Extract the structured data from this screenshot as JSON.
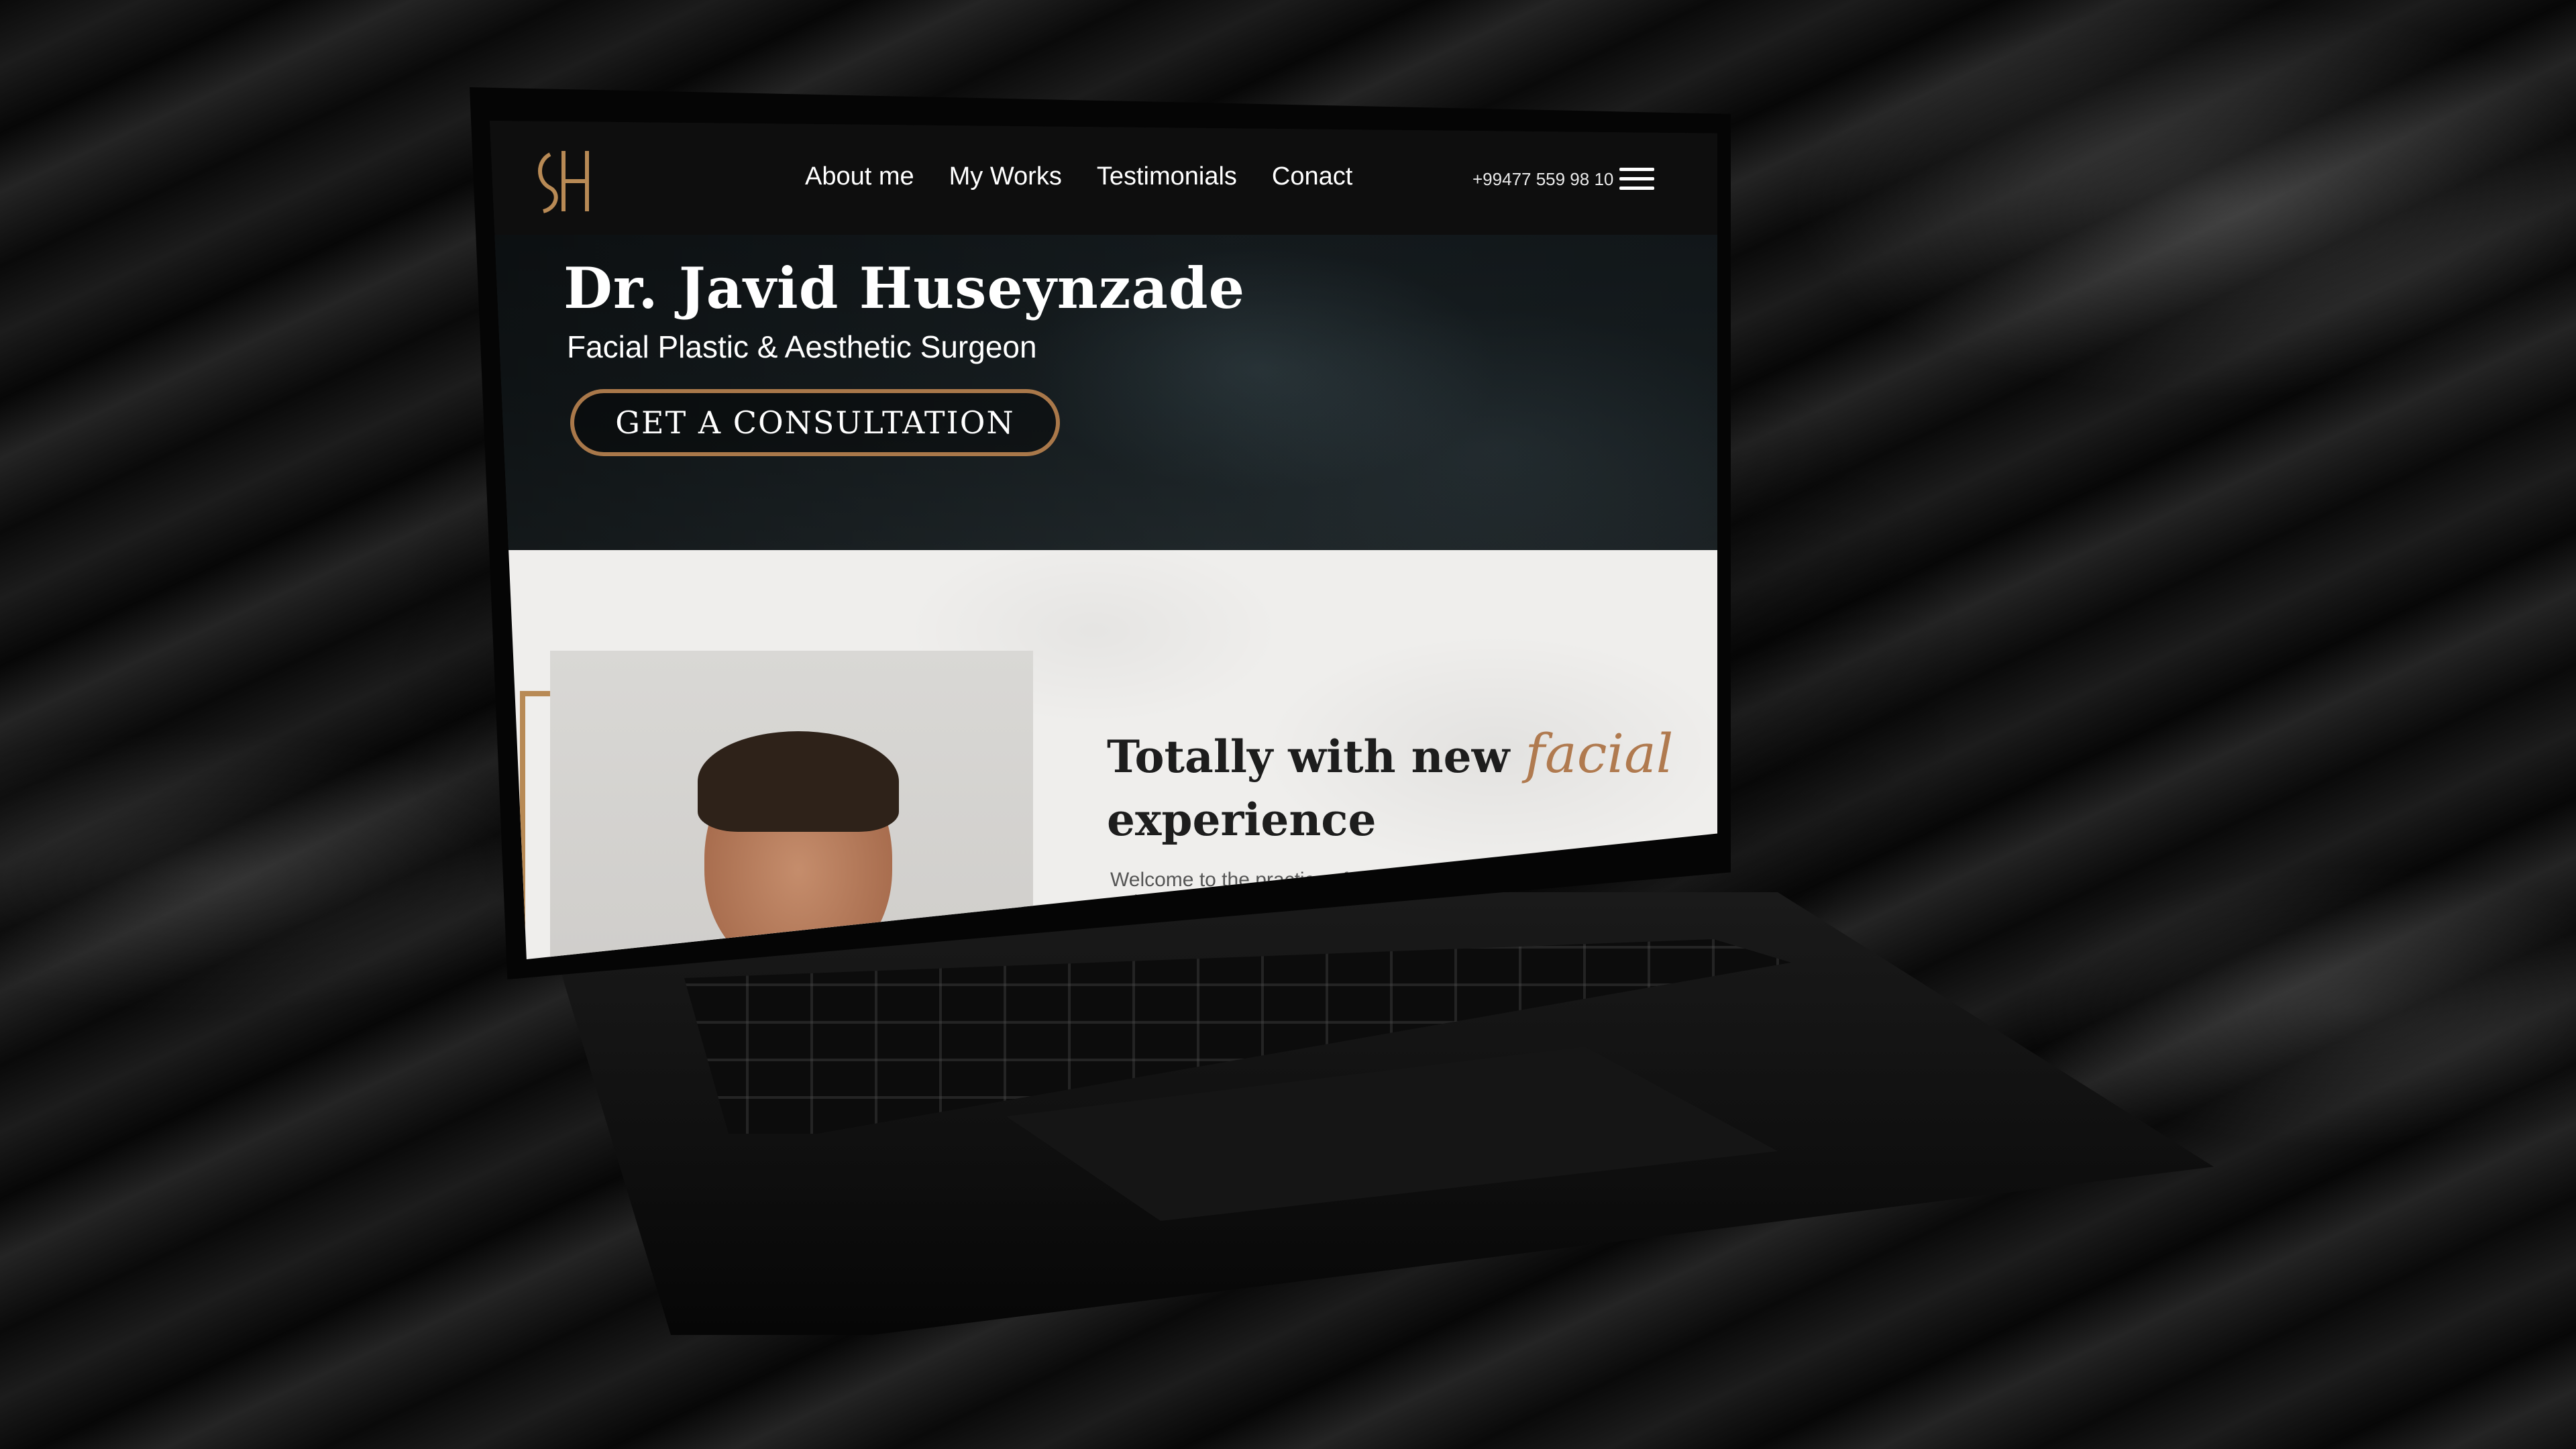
{
  "site": {
    "logo_text": "JH",
    "nav": [
      {
        "label": "About me"
      },
      {
        "label": "My Works"
      },
      {
        "label": "Testimonials"
      },
      {
        "label": "Conact"
      }
    ],
    "phone": "+99477 559 98 10"
  },
  "hero": {
    "title": "Dr. Javid Huseynzade",
    "subtitle": "Facial Plastic & Aesthetic Surgeon",
    "cta_label": "GET A CONSULTATION"
  },
  "about": {
    "heading_part1": "Totally with new ",
    "heading_accent": "facial",
    "heading_part2": "experience",
    "intro": "Welcome to the practice of Dr. Javid Huseynzade, where artistry"
  },
  "colors": {
    "accent": "#b88a55",
    "header_bg": "#0e0e0e",
    "about_bg": "#efeeec"
  },
  "icons": {
    "menu": "hamburger-menu-icon"
  }
}
